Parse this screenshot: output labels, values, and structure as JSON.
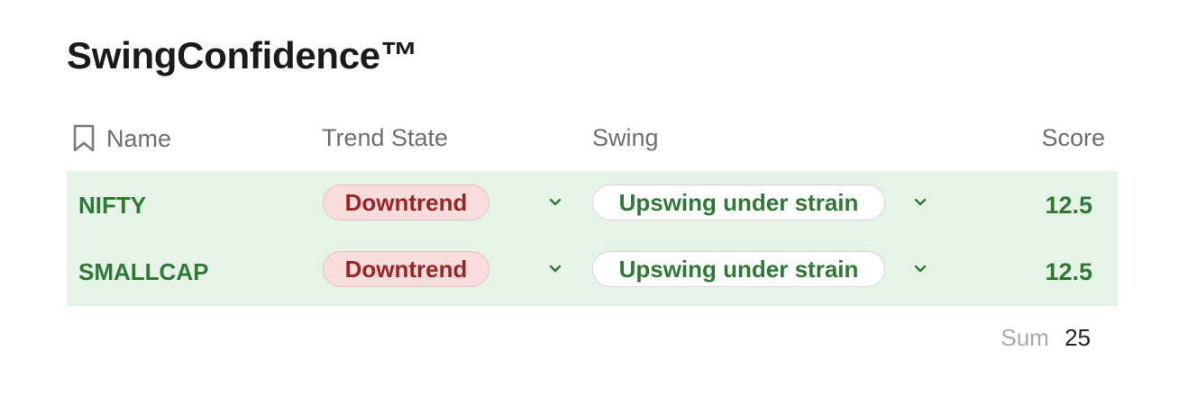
{
  "title": "SwingConfidence™",
  "table": {
    "columns": {
      "name": "Name",
      "trend_state": "Trend State",
      "swing": "Swing",
      "score": "Score"
    },
    "rows": [
      {
        "name": "NIFTY",
        "trend_state": "Downtrend",
        "swing": "Upswing under strain",
        "score": "12.5"
      },
      {
        "name": "SMALLCAP",
        "trend_state": "Downtrend",
        "swing": "Upswing under strain",
        "score": "12.5"
      }
    ],
    "footer": {
      "sum_label": "Sum",
      "sum_value": "25"
    }
  },
  "icons": {
    "bookmark": "bookmark-icon",
    "chevron": "chevron-down-icon"
  },
  "colors": {
    "row_background": "#e6f4e7",
    "positive_text": "#2e7a35",
    "downtrend_background": "#f9dcdc",
    "downtrend_text": "#9c2525"
  }
}
